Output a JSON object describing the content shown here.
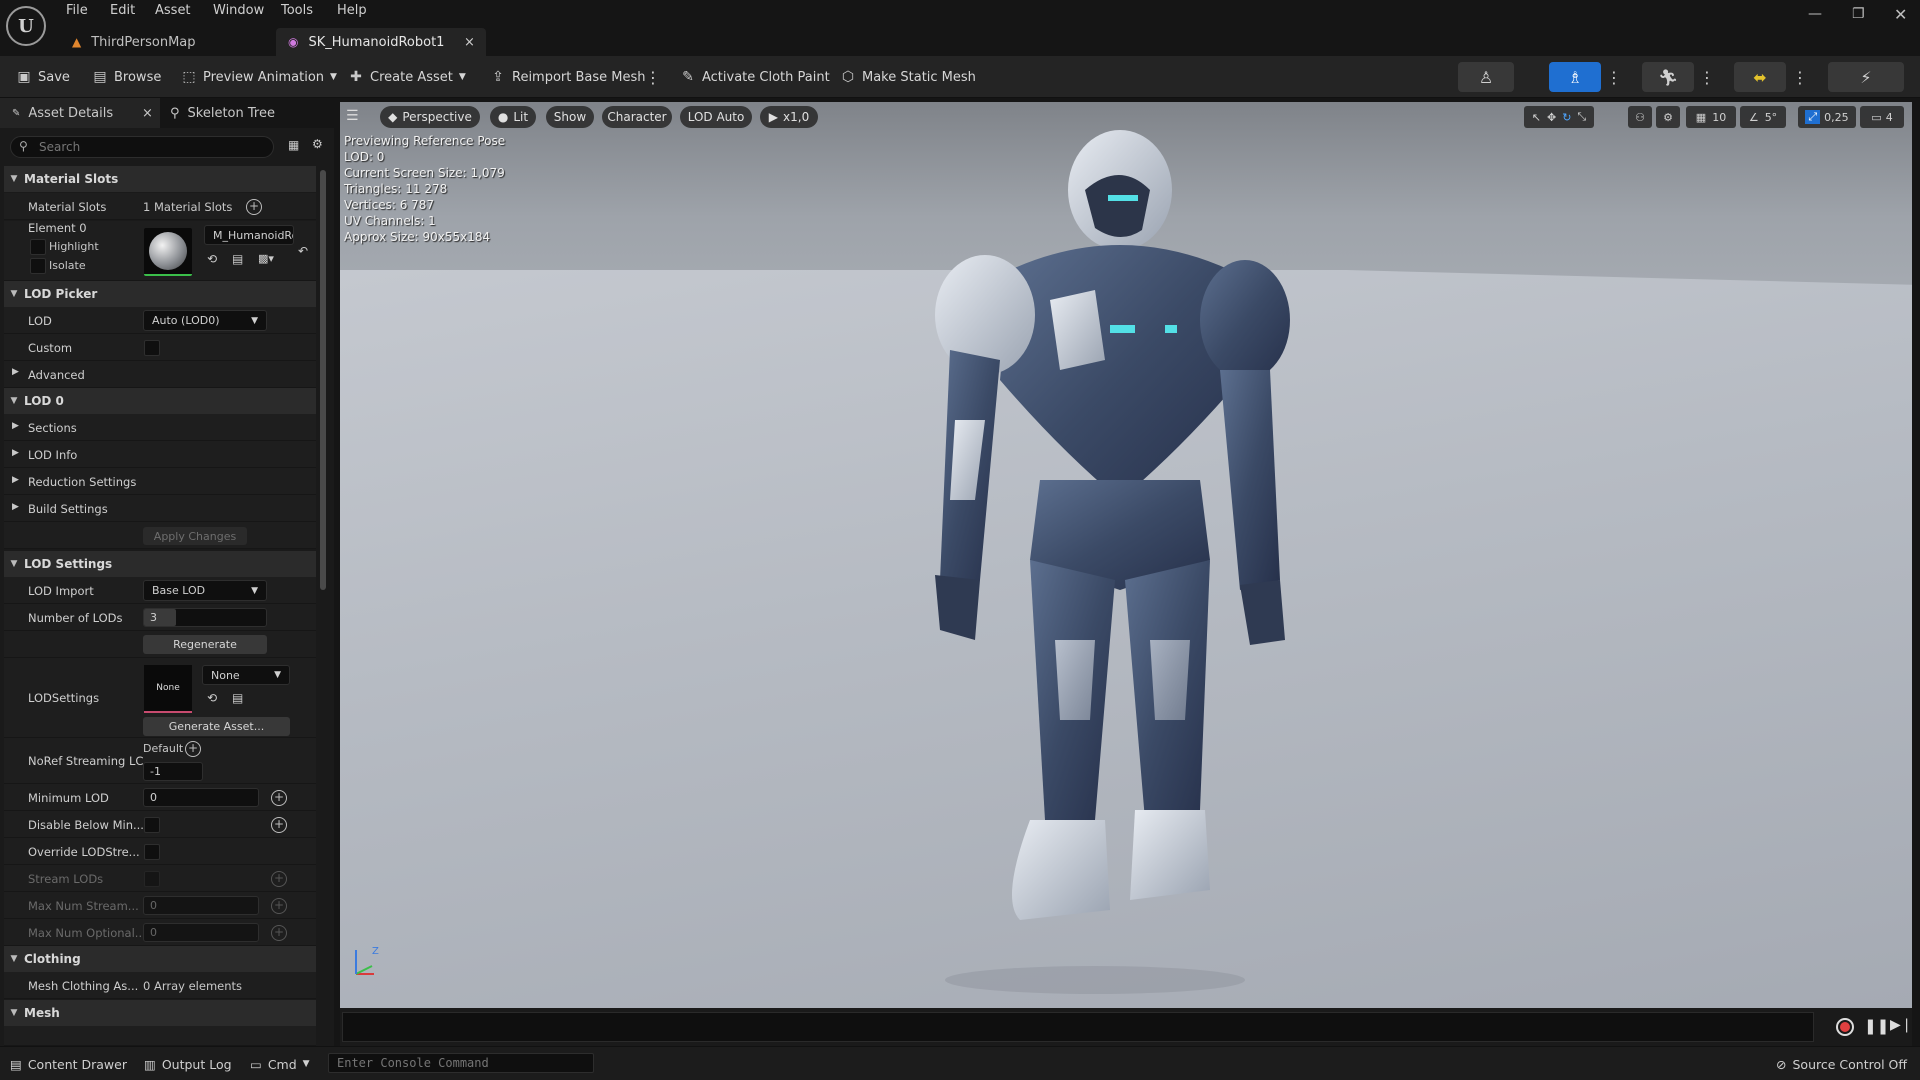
{
  "menu": [
    "File",
    "Edit",
    "Asset",
    "Window",
    "Tools",
    "Help"
  ],
  "tabs": [
    {
      "label": "ThirdPersonMap"
    },
    {
      "label": "SK_HumanoidRobot1",
      "close": "×"
    }
  ],
  "toolbar": {
    "save": "Save",
    "browse": "Browse",
    "preview_animation": "Preview Animation",
    "create_asset": "Create Asset",
    "reimport": "Reimport Base Mesh",
    "cloth_paint": "Activate Cloth Paint",
    "static_mesh": "Make Static Mesh"
  },
  "panel_tabs": {
    "details": "Asset Details",
    "skeleton": "Skeleton Tree",
    "close": "×"
  },
  "search": {
    "placeholder": "Search"
  },
  "details": {
    "material_slots_section": "Material Slots",
    "material_slots_label": "Material Slots",
    "material_slots_value": "1 Material Slots",
    "element0": "Element 0",
    "highlight": "Highlight",
    "isolate": "Isolate",
    "material_name": "M_HumanoidRob",
    "lod_picker_section": "LOD Picker",
    "lod_label": "LOD",
    "lod_value": "Auto (LOD0)",
    "custom": "Custom",
    "advanced": "Advanced",
    "lod0_section": "LOD 0",
    "sections": "Sections",
    "lod_info": "LOD Info",
    "reduction": "Reduction Settings",
    "build": "Build Settings",
    "apply_changes": "Apply Changes",
    "lod_settings_section": "LOD Settings",
    "lod_import": "LOD Import",
    "lod_import_value": "Base LOD",
    "num_lods": "Number of LODs",
    "num_lods_value": "3",
    "regenerate": "Regenerate",
    "lodsettings": "LODSettings",
    "lodsettings_thumb": "None",
    "lodsettings_value": "None",
    "generate_asset": "Generate Asset...",
    "noref": "NoRef Streaming LC",
    "default": "Default",
    "noref_value": "-1",
    "min_lod": "Minimum LOD",
    "min_lod_value": "0",
    "disable_below": "Disable Below Min...",
    "override": "Override LODStre...",
    "stream_lods": "Stream LODs",
    "max_stream": "Max Num Stream...",
    "max_stream_value": "0",
    "max_optional": "Max Num Optional...",
    "max_optional_value": "0",
    "clothing_section": "Clothing",
    "mesh_clothing": "Mesh Clothing As...",
    "mesh_clothing_value": "0 Array elements",
    "mesh_section": "Mesh"
  },
  "viewport": {
    "perspective": "Perspective",
    "lit": "Lit",
    "show": "Show",
    "character": "Character",
    "lod_auto": "LOD Auto",
    "play_speed": "x1,0",
    "grid_snap": "10",
    "rot_snap": "5°",
    "scale_snap": "0,25",
    "cam_speed": "4",
    "stats": [
      "Previewing Reference Pose",
      "LOD: 0",
      "Current Screen Size: 1,079",
      "Triangles: 11 278",
      "Vertices: 6 787",
      "UV Channels: 1",
      "Approx Size: 90x55x184"
    ]
  },
  "statusbar": {
    "content_drawer": "Content Drawer",
    "output_log": "Output Log",
    "cmd": "Cmd",
    "console_placeholder": "Enter Console Command",
    "source_control": "Source Control Off"
  },
  "colors": {
    "accent": "#1f6fd1",
    "bg": "#1a1a1a",
    "panel": "#242424"
  }
}
